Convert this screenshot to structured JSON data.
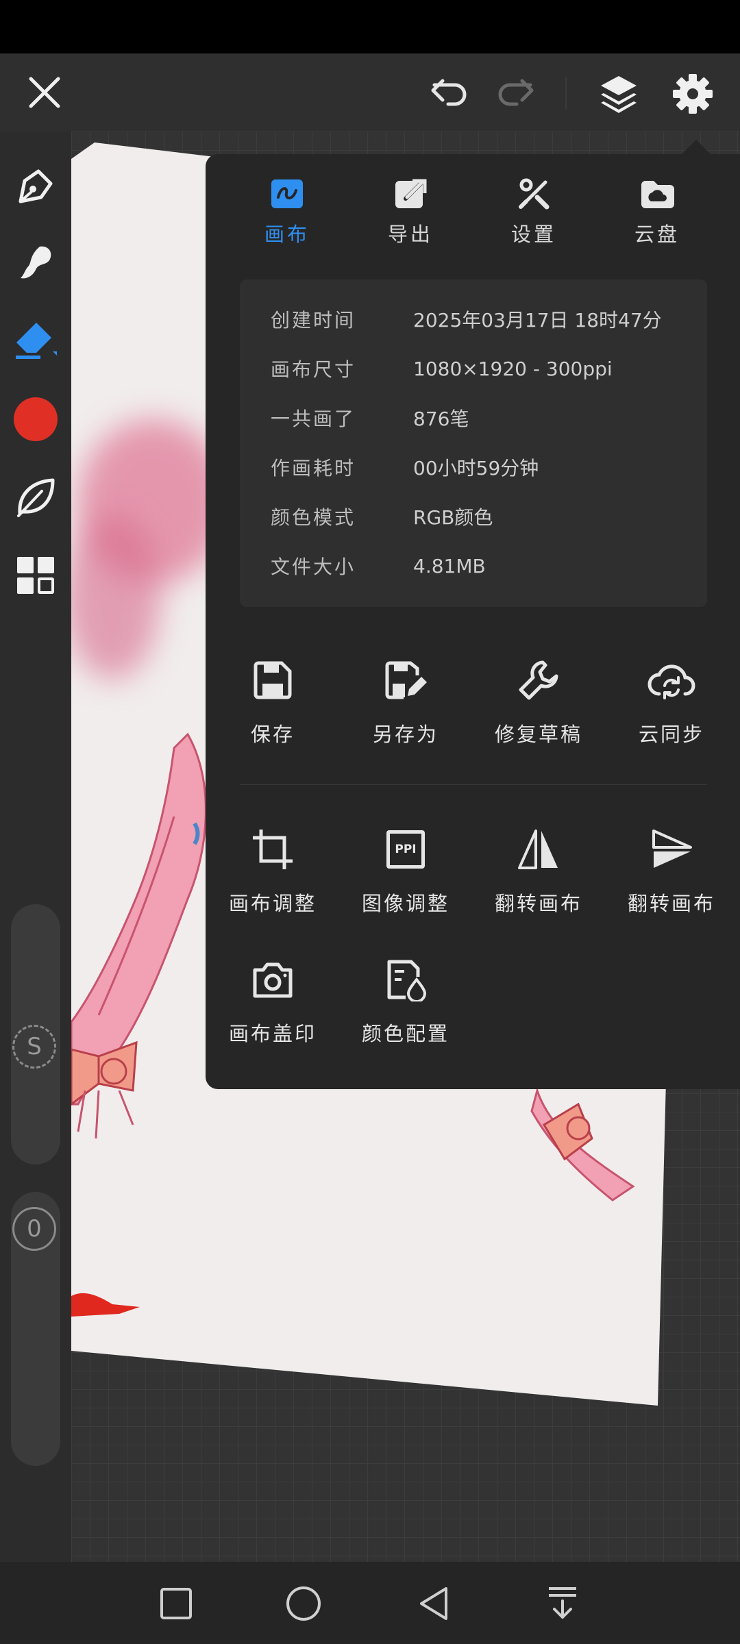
{
  "toolbar": {
    "icons": [
      "close-icon",
      "undo-icon",
      "redo-icon",
      "layers-icon",
      "gear-icon"
    ]
  },
  "tools": [
    "pen-icon",
    "smudge-brush-icon",
    "eraser-icon",
    "color-swatch",
    "leaf-brush-icon",
    "grid-apps-icon"
  ],
  "current_color": "#e03025",
  "sliders": {
    "smoothing_label": "S",
    "opacity_label": "0"
  },
  "panel": {
    "tabs": [
      {
        "label": "画布",
        "icon": "canvas-icon",
        "active": true
      },
      {
        "label": "导出",
        "icon": "export-icon",
        "active": false
      },
      {
        "label": "设置",
        "icon": "settings-icon",
        "active": false
      },
      {
        "label": "云盘",
        "icon": "cloud-drive-icon",
        "active": false
      }
    ],
    "info": [
      {
        "key": "创建时间",
        "value": "2025年03月17日 18时47分"
      },
      {
        "key": "画布尺寸",
        "value": "1080×1920 - 300ppi"
      },
      {
        "key": "一共画了",
        "value": "876笔"
      },
      {
        "key": "作画耗时",
        "value": "00小时59分钟"
      },
      {
        "key": "颜色模式",
        "value": "RGB颜色"
      },
      {
        "key": "文件大小",
        "value": "4.81MB"
      }
    ],
    "actions_row1": [
      {
        "label": "保存",
        "icon": "save-icon"
      },
      {
        "label": "另存为",
        "icon": "save-as-icon"
      },
      {
        "label": "修复草稿",
        "icon": "wrench-icon"
      },
      {
        "label": "云同步",
        "icon": "cloud-sync-icon"
      }
    ],
    "actions_row2": [
      {
        "label": "画布调整",
        "icon": "crop-icon"
      },
      {
        "label": "图像调整",
        "icon": "ppi-icon",
        "icon_text": "PPI"
      },
      {
        "label": "翻转画布",
        "icon": "flip-horizontal-icon"
      },
      {
        "label": "翻转画布",
        "icon": "flip-vertical-icon"
      }
    ],
    "actions_row3": [
      {
        "label": "画布盖印",
        "icon": "camera-icon"
      },
      {
        "label": "颜色配置",
        "icon": "color-profile-icon"
      }
    ]
  },
  "accent_color": "#2f8ff0",
  "nav": [
    "recent-apps-icon",
    "home-icon",
    "back-icon",
    "notification-drawer-icon"
  ]
}
